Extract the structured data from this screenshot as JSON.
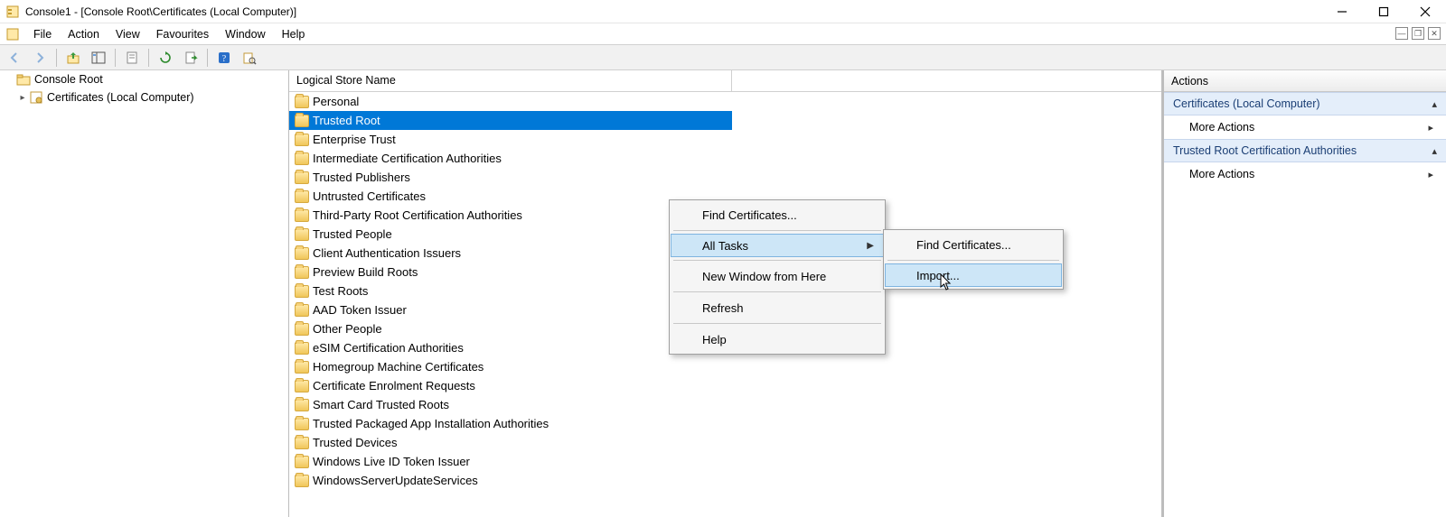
{
  "window": {
    "title": "Console1 - [Console Root\\Certificates (Local Computer)]"
  },
  "menubar": {
    "items": [
      "File",
      "Action",
      "View",
      "Favourites",
      "Window",
      "Help"
    ]
  },
  "tree": {
    "root": "Console Root",
    "child": "Certificates (Local Computer)"
  },
  "list": {
    "header": "Logical Store Name",
    "items": [
      "Personal",
      "Trusted Root Certification Authorities",
      "Enterprise Trust",
      "Intermediate Certification Authorities",
      "Trusted Publishers",
      "Untrusted Certificates",
      "Third-Party Root Certification Authorities",
      "Trusted People",
      "Client Authentication Issuers",
      "Preview Build Roots",
      "Test Roots",
      "AAD Token Issuer",
      "Other People",
      "eSIM Certification Authorities",
      "Homegroup Machine Certificates",
      "Certificate Enrolment Requests",
      "Smart Card Trusted Roots",
      "Trusted Packaged App Installation Authorities",
      "Trusted Devices",
      "Windows Live ID Token Issuer",
      "WindowsServerUpdateServices"
    ],
    "selected_index": 1,
    "selected_partial_text": "Trusted Root"
  },
  "context_main": {
    "items": [
      {
        "label": "Find Certificates...",
        "submenu": false
      },
      {
        "sep": true
      },
      {
        "label": "All Tasks",
        "submenu": true,
        "highlight": true
      },
      {
        "sep": true
      },
      {
        "label": "New Window from Here",
        "submenu": false
      },
      {
        "sep": true
      },
      {
        "label": "Refresh",
        "submenu": false
      },
      {
        "sep": true
      },
      {
        "label": "Help",
        "submenu": false
      }
    ]
  },
  "context_sub": {
    "items": [
      {
        "label": "Find Certificates...",
        "highlight": false
      },
      {
        "sep": true
      },
      {
        "label": "Import...",
        "highlight": true
      }
    ]
  },
  "actions": {
    "header": "Actions",
    "section1": "Certificates (Local Computer)",
    "link1": "More Actions",
    "section2": "Trusted Root Certification Authorities",
    "link2": "More Actions"
  }
}
